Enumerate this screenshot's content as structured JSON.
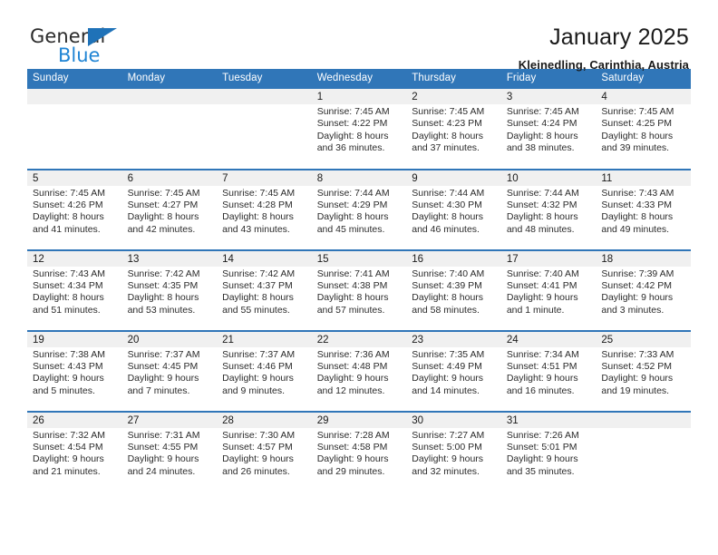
{
  "logo": {
    "word1": "General",
    "word2": "Blue",
    "triangle_color": "#1f72b8",
    "word2_color": "#1f84d4",
    "icon": "general-blue-logo"
  },
  "header": {
    "title": "January 2025",
    "subtitle": "Kleinedling, Carinthia, Austria"
  },
  "calendar": {
    "accent_color": "#3076b8",
    "daynum_band_color": "#f0f0f0",
    "weekday_headers": [
      "Sunday",
      "Monday",
      "Tuesday",
      "Wednesday",
      "Thursday",
      "Friday",
      "Saturday"
    ],
    "labels": {
      "sunrise": "Sunrise:",
      "sunset": "Sunset:",
      "daylight": "Daylight:"
    },
    "weeks": [
      [
        {
          "day": "",
          "blank": true
        },
        {
          "day": "",
          "blank": true
        },
        {
          "day": "",
          "blank": true
        },
        {
          "day": "1",
          "sunrise": "Sunrise: 7:45 AM",
          "sunset": "Sunset: 4:22 PM",
          "daylight_1": "Daylight: 8 hours",
          "daylight_2": "and 36 minutes."
        },
        {
          "day": "2",
          "sunrise": "Sunrise: 7:45 AM",
          "sunset": "Sunset: 4:23 PM",
          "daylight_1": "Daylight: 8 hours",
          "daylight_2": "and 37 minutes."
        },
        {
          "day": "3",
          "sunrise": "Sunrise: 7:45 AM",
          "sunset": "Sunset: 4:24 PM",
          "daylight_1": "Daylight: 8 hours",
          "daylight_2": "and 38 minutes."
        },
        {
          "day": "4",
          "sunrise": "Sunrise: 7:45 AM",
          "sunset": "Sunset: 4:25 PM",
          "daylight_1": "Daylight: 8 hours",
          "daylight_2": "and 39 minutes."
        }
      ],
      [
        {
          "day": "5",
          "sunrise": "Sunrise: 7:45 AM",
          "sunset": "Sunset: 4:26 PM",
          "daylight_1": "Daylight: 8 hours",
          "daylight_2": "and 41 minutes."
        },
        {
          "day": "6",
          "sunrise": "Sunrise: 7:45 AM",
          "sunset": "Sunset: 4:27 PM",
          "daylight_1": "Daylight: 8 hours",
          "daylight_2": "and 42 minutes."
        },
        {
          "day": "7",
          "sunrise": "Sunrise: 7:45 AM",
          "sunset": "Sunset: 4:28 PM",
          "daylight_1": "Daylight: 8 hours",
          "daylight_2": "and 43 minutes."
        },
        {
          "day": "8",
          "sunrise": "Sunrise: 7:44 AM",
          "sunset": "Sunset: 4:29 PM",
          "daylight_1": "Daylight: 8 hours",
          "daylight_2": "and 45 minutes."
        },
        {
          "day": "9",
          "sunrise": "Sunrise: 7:44 AM",
          "sunset": "Sunset: 4:30 PM",
          "daylight_1": "Daylight: 8 hours",
          "daylight_2": "and 46 minutes."
        },
        {
          "day": "10",
          "sunrise": "Sunrise: 7:44 AM",
          "sunset": "Sunset: 4:32 PM",
          "daylight_1": "Daylight: 8 hours",
          "daylight_2": "and 48 minutes."
        },
        {
          "day": "11",
          "sunrise": "Sunrise: 7:43 AM",
          "sunset": "Sunset: 4:33 PM",
          "daylight_1": "Daylight: 8 hours",
          "daylight_2": "and 49 minutes."
        }
      ],
      [
        {
          "day": "12",
          "sunrise": "Sunrise: 7:43 AM",
          "sunset": "Sunset: 4:34 PM",
          "daylight_1": "Daylight: 8 hours",
          "daylight_2": "and 51 minutes."
        },
        {
          "day": "13",
          "sunrise": "Sunrise: 7:42 AM",
          "sunset": "Sunset: 4:35 PM",
          "daylight_1": "Daylight: 8 hours",
          "daylight_2": "and 53 minutes."
        },
        {
          "day": "14",
          "sunrise": "Sunrise: 7:42 AM",
          "sunset": "Sunset: 4:37 PM",
          "daylight_1": "Daylight: 8 hours",
          "daylight_2": "and 55 minutes."
        },
        {
          "day": "15",
          "sunrise": "Sunrise: 7:41 AM",
          "sunset": "Sunset: 4:38 PM",
          "daylight_1": "Daylight: 8 hours",
          "daylight_2": "and 57 minutes."
        },
        {
          "day": "16",
          "sunrise": "Sunrise: 7:40 AM",
          "sunset": "Sunset: 4:39 PM",
          "daylight_1": "Daylight: 8 hours",
          "daylight_2": "and 58 minutes."
        },
        {
          "day": "17",
          "sunrise": "Sunrise: 7:40 AM",
          "sunset": "Sunset: 4:41 PM",
          "daylight_1": "Daylight: 9 hours",
          "daylight_2": "and 1 minute."
        },
        {
          "day": "18",
          "sunrise": "Sunrise: 7:39 AM",
          "sunset": "Sunset: 4:42 PM",
          "daylight_1": "Daylight: 9 hours",
          "daylight_2": "and 3 minutes."
        }
      ],
      [
        {
          "day": "19",
          "sunrise": "Sunrise: 7:38 AM",
          "sunset": "Sunset: 4:43 PM",
          "daylight_1": "Daylight: 9 hours",
          "daylight_2": "and 5 minutes."
        },
        {
          "day": "20",
          "sunrise": "Sunrise: 7:37 AM",
          "sunset": "Sunset: 4:45 PM",
          "daylight_1": "Daylight: 9 hours",
          "daylight_2": "and 7 minutes."
        },
        {
          "day": "21",
          "sunrise": "Sunrise: 7:37 AM",
          "sunset": "Sunset: 4:46 PM",
          "daylight_1": "Daylight: 9 hours",
          "daylight_2": "and 9 minutes."
        },
        {
          "day": "22",
          "sunrise": "Sunrise: 7:36 AM",
          "sunset": "Sunset: 4:48 PM",
          "daylight_1": "Daylight: 9 hours",
          "daylight_2": "and 12 minutes."
        },
        {
          "day": "23",
          "sunrise": "Sunrise: 7:35 AM",
          "sunset": "Sunset: 4:49 PM",
          "daylight_1": "Daylight: 9 hours",
          "daylight_2": "and 14 minutes."
        },
        {
          "day": "24",
          "sunrise": "Sunrise: 7:34 AM",
          "sunset": "Sunset: 4:51 PM",
          "daylight_1": "Daylight: 9 hours",
          "daylight_2": "and 16 minutes."
        },
        {
          "day": "25",
          "sunrise": "Sunrise: 7:33 AM",
          "sunset": "Sunset: 4:52 PM",
          "daylight_1": "Daylight: 9 hours",
          "daylight_2": "and 19 minutes."
        }
      ],
      [
        {
          "day": "26",
          "sunrise": "Sunrise: 7:32 AM",
          "sunset": "Sunset: 4:54 PM",
          "daylight_1": "Daylight: 9 hours",
          "daylight_2": "and 21 minutes."
        },
        {
          "day": "27",
          "sunrise": "Sunrise: 7:31 AM",
          "sunset": "Sunset: 4:55 PM",
          "daylight_1": "Daylight: 9 hours",
          "daylight_2": "and 24 minutes."
        },
        {
          "day": "28",
          "sunrise": "Sunrise: 7:30 AM",
          "sunset": "Sunset: 4:57 PM",
          "daylight_1": "Daylight: 9 hours",
          "daylight_2": "and 26 minutes."
        },
        {
          "day": "29",
          "sunrise": "Sunrise: 7:28 AM",
          "sunset": "Sunset: 4:58 PM",
          "daylight_1": "Daylight: 9 hours",
          "daylight_2": "and 29 minutes."
        },
        {
          "day": "30",
          "sunrise": "Sunrise: 7:27 AM",
          "sunset": "Sunset: 5:00 PM",
          "daylight_1": "Daylight: 9 hours",
          "daylight_2": "and 32 minutes."
        },
        {
          "day": "31",
          "sunrise": "Sunrise: 7:26 AM",
          "sunset": "Sunset: 5:01 PM",
          "daylight_1": "Daylight: 9 hours",
          "daylight_2": "and 35 minutes."
        },
        {
          "day": "",
          "blank": true
        }
      ]
    ]
  }
}
